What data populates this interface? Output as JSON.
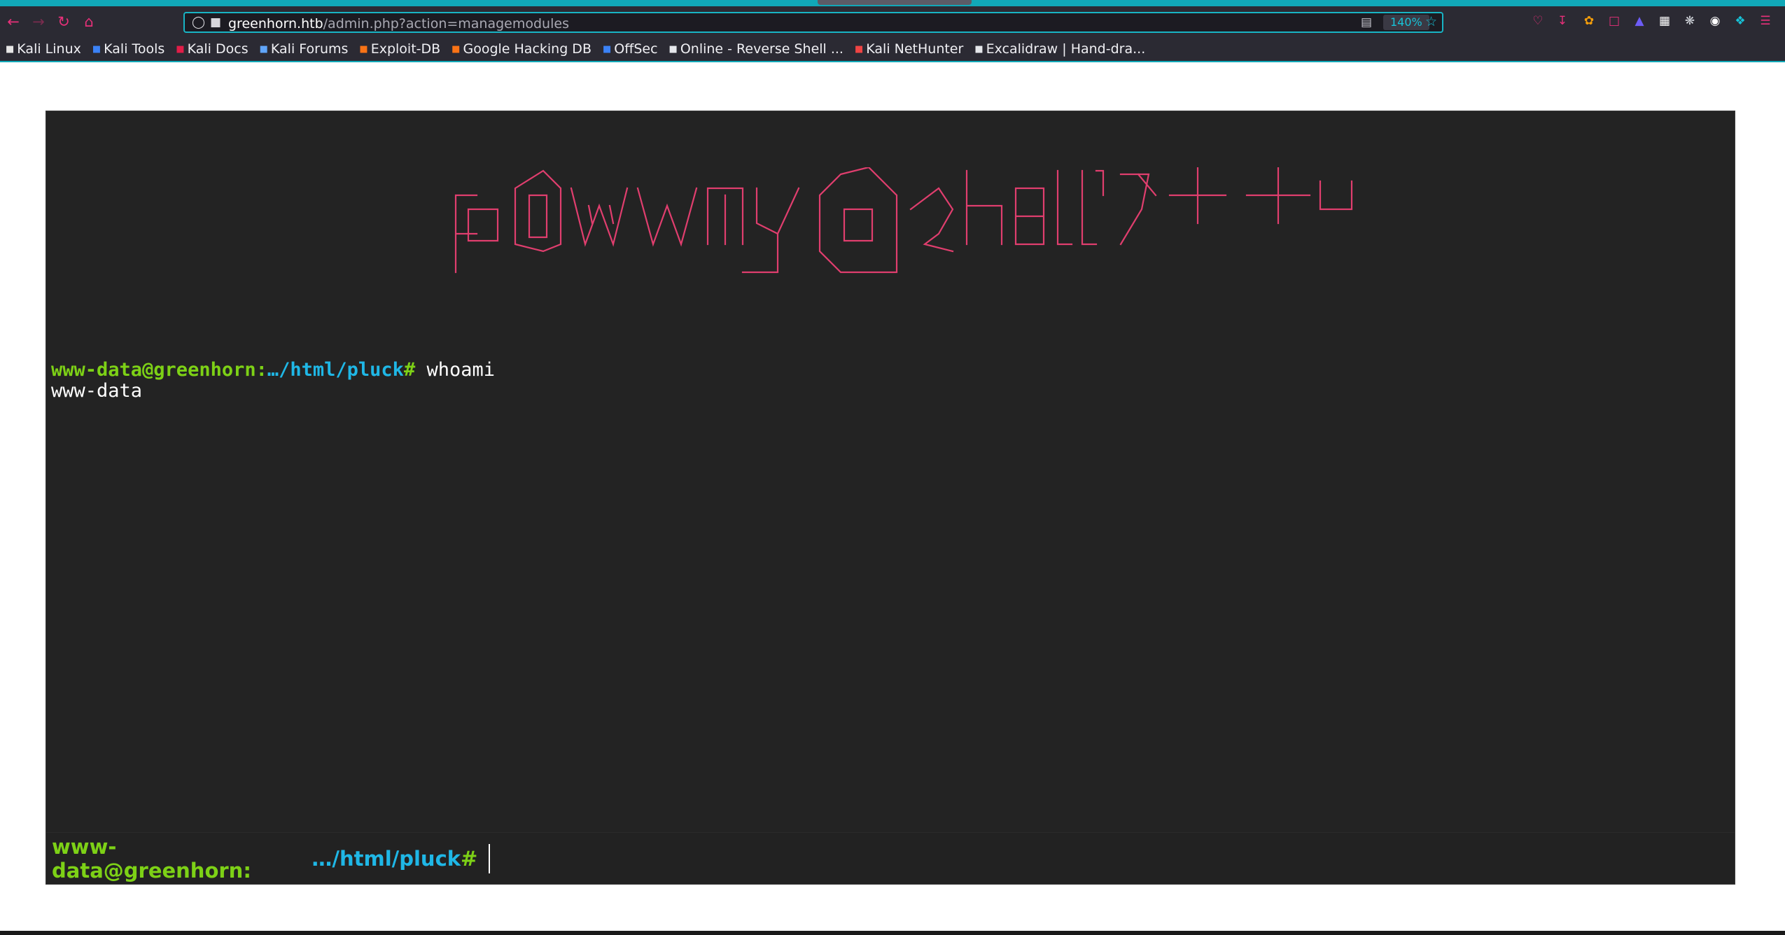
{
  "browser": {
    "url_host": "greenhorn.htb",
    "url_path": "/admin.php?action=managemodules",
    "zoom": "140%"
  },
  "bookmarks": [
    {
      "label": "Kali Linux",
      "icon": "kali-dragon-icon",
      "color": "#e6e6e6"
    },
    {
      "label": "Kali Tools",
      "icon": "kali-tools-icon",
      "color": "#3b82f6"
    },
    {
      "label": "Kali Docs",
      "icon": "kali-docs-icon",
      "color": "#e11d48"
    },
    {
      "label": "Kali Forums",
      "icon": "kali-forums-icon",
      "color": "#60a5fa"
    },
    {
      "label": "Exploit-DB",
      "icon": "exploit-db-icon",
      "color": "#f97316"
    },
    {
      "label": "Google Hacking DB",
      "icon": "ghdb-icon",
      "color": "#f97316"
    },
    {
      "label": "OffSec",
      "icon": "offsec-icon",
      "color": "#3b82f6"
    },
    {
      "label": "Online - Reverse Shell ...",
      "icon": "skull-icon",
      "color": "#e5e7eb"
    },
    {
      "label": "Kali NetHunter",
      "icon": "nethunter-icon",
      "color": "#ef4444"
    },
    {
      "label": "Excalidraw | Hand-dra...",
      "icon": "excalidraw-icon",
      "color": "#e5e7eb"
    }
  ],
  "terminal": {
    "banner_color": "#e03e6e",
    "prompt_user_host": "www-data@greenhorn:",
    "prompt_path": "…/html/pluck",
    "prompt_symbol": "#",
    "history_command": "whoami",
    "history_output": "www-data",
    "input_value": ""
  },
  "colors": {
    "accent": "#11a8b8",
    "prompt_green": "#7dd116",
    "prompt_blue": "#1fb7e6",
    "terminal_bg": "#232323"
  }
}
